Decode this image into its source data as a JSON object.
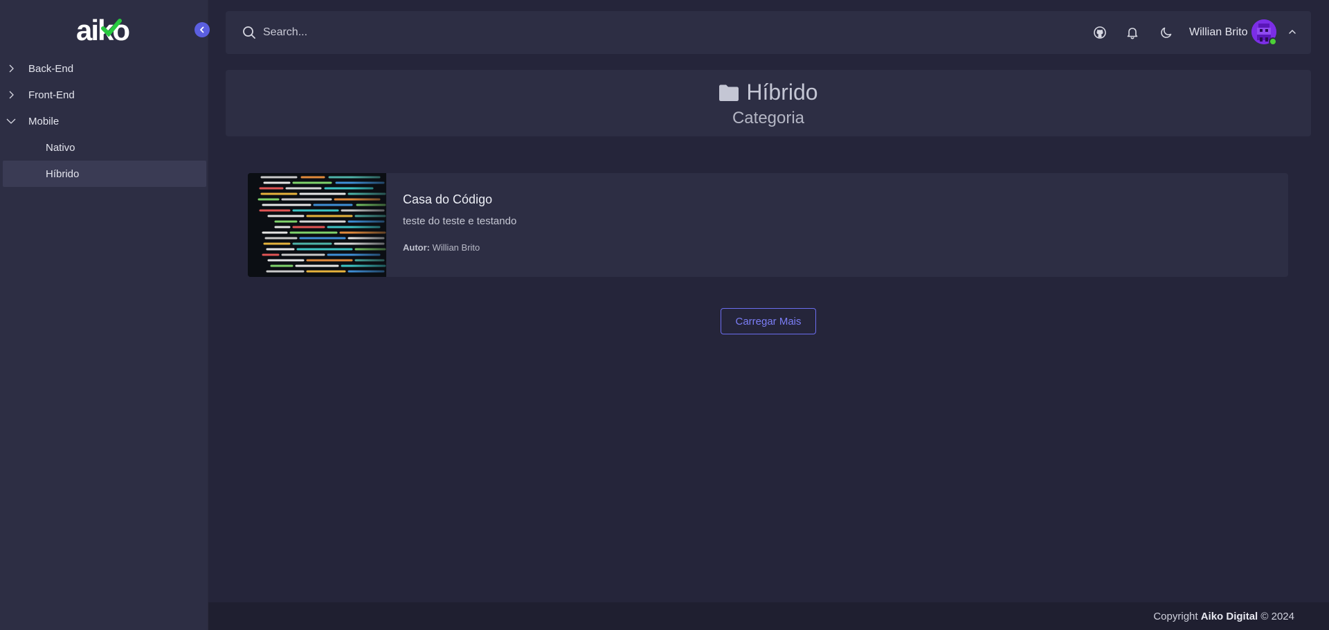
{
  "brand": {
    "logo_text": "aiko"
  },
  "sidebar": {
    "items": [
      {
        "label": "Back-End",
        "expanded": false
      },
      {
        "label": "Front-End",
        "expanded": false
      },
      {
        "label": "Mobile",
        "expanded": true,
        "children": [
          {
            "label": "Nativo",
            "active": false
          },
          {
            "label": "Híbrido",
            "active": true
          }
        ]
      }
    ]
  },
  "topbar": {
    "search_placeholder": "Search...",
    "icons": [
      "github-icon",
      "bell-icon",
      "moon-icon"
    ],
    "user_name": "Willian Brito",
    "status": "online"
  },
  "header": {
    "title": "Híbrido",
    "subtitle": "Categoria",
    "icon": "folder-icon"
  },
  "articles": [
    {
      "title": "Casa do Código",
      "description": "teste do teste e testando",
      "author_label": "Autor:",
      "author": "Willian Brito"
    }
  ],
  "load_more_label": "Carregar Mais",
  "footer": {
    "prefix": "Copyright",
    "company": "Aiko Digital",
    "suffix": "© 2024"
  },
  "colors": {
    "accent": "#5b5fe0",
    "sidebar_bg": "#2d2e44",
    "page_bg": "#25253a",
    "online": "#4cd137"
  }
}
